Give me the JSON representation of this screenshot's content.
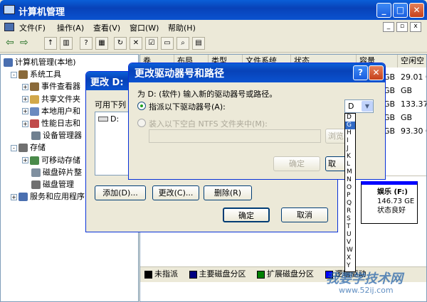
{
  "main_window": {
    "title": "计算机管理",
    "menu": [
      "文件(F)",
      "操作(A)",
      "查看(V)",
      "窗口(W)",
      "帮助(H)"
    ],
    "tree": [
      {
        "label": "计算机管理(本地)",
        "level": 0,
        "exp": ""
      },
      {
        "label": "系统工具",
        "level": 1,
        "exp": "-"
      },
      {
        "label": "事件查看器",
        "level": 2,
        "exp": "+"
      },
      {
        "label": "共享文件夹",
        "level": 2,
        "exp": "+"
      },
      {
        "label": "本地用户和",
        "level": 2,
        "exp": "+"
      },
      {
        "label": "性能日志和",
        "level": 2,
        "exp": "+"
      },
      {
        "label": "设备管理器",
        "level": 2,
        "exp": ""
      },
      {
        "label": "存储",
        "level": 1,
        "exp": "-"
      },
      {
        "label": "可移动存储",
        "level": 2,
        "exp": "+"
      },
      {
        "label": "磁盘碎片整",
        "level": 2,
        "exp": ""
      },
      {
        "label": "磁盘管理",
        "level": 2,
        "exp": ""
      },
      {
        "label": "服务和应用程序",
        "level": 1,
        "exp": "+"
      }
    ],
    "columns": [
      "卷",
      "布局",
      "类型",
      "文件系统",
      "状态",
      "容量",
      "空闲空"
    ],
    "free_space": [
      "29.01 G",
      "GB",
      "133.37",
      "GB",
      "93.30 G"
    ],
    "capacity_suffix": [
      "GB",
      "GB",
      "GB",
      "GB",
      "GB"
    ],
    "legend": [
      "未指派",
      "主要磁盘分区",
      "扩展磁盘分区",
      "逻辑驱动"
    ],
    "legend_colors": [
      "#000000",
      "#000080",
      "#008000",
      "#0000ff"
    ],
    "disk_block": {
      "name": "娱乐 (F:)",
      "size": "146.73 GE",
      "status": "状态良好"
    }
  },
  "mid_dialog": {
    "title": "更改 D:",
    "label": "可用下列",
    "list_item": "D:",
    "add_label": "添加(D)...",
    "change_label": "更改(C)...",
    "delete_label": "删除(R)",
    "ok_label": "确定",
    "cancel_label": "取消"
  },
  "front_dialog": {
    "title": "更改驱动器号和路径",
    "description": "为 D: (软件) 输入新的驱动器号或路径。",
    "radio1": "指派以下驱动器号(A):",
    "radio2": "装入以下空白 NTFS 文件夹中(M):",
    "browse_label": "浏览",
    "ok_label": "确定",
    "cancel_label": "取",
    "selected_letter": "D",
    "letters": [
      "D",
      "G",
      "H",
      "I",
      "J",
      "K",
      "L",
      "M",
      "N",
      "O",
      "P",
      "Q",
      "R",
      "S",
      "T",
      "U",
      "V",
      "W",
      "X",
      "Y"
    ]
  },
  "watermark": {
    "text": "我要学技术网",
    "url": "www.52ij.com"
  }
}
